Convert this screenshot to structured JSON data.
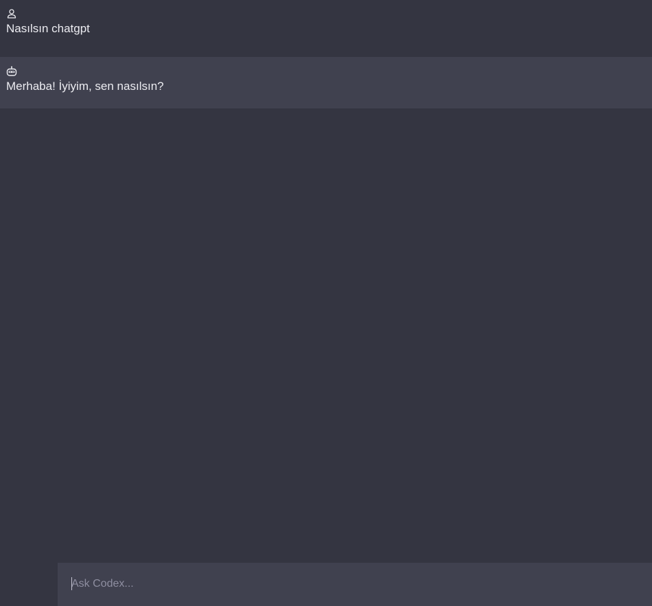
{
  "conversation": {
    "messages": [
      {
        "role": "user",
        "icon": "user-icon",
        "text": "Nasılsın chatgpt"
      },
      {
        "role": "assistant",
        "icon": "robot-icon",
        "text": "Merhaba! İyiyim, sen nasılsın?"
      }
    ]
  },
  "composer": {
    "placeholder": "Ask Codex...",
    "value": ""
  },
  "colors": {
    "background": "#343541",
    "assistant_row": "#40414f",
    "composer": "#40414f",
    "text": "#ececf1",
    "placeholder": "#8e8ea0"
  }
}
